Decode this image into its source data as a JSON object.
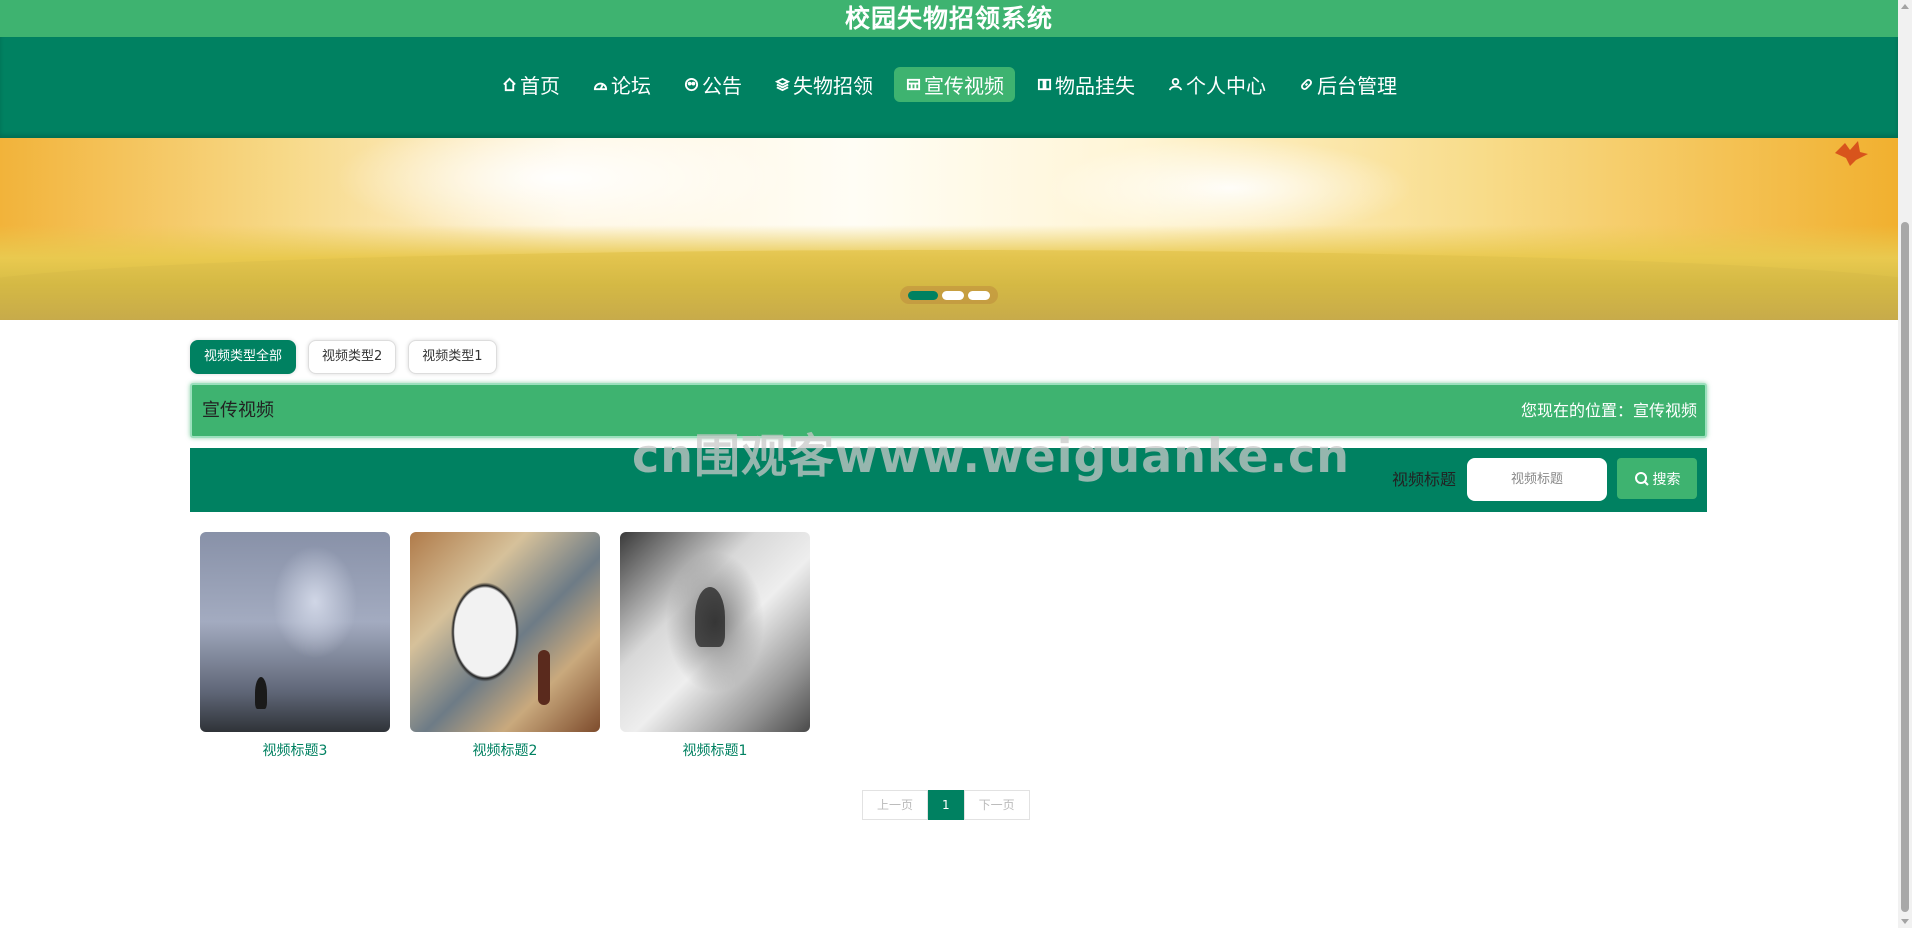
{
  "header": {
    "title": "校园失物招领系统"
  },
  "nav": {
    "items": [
      {
        "label": "首页",
        "icon": "home-icon"
      },
      {
        "label": "论坛",
        "icon": "forum-icon"
      },
      {
        "label": "公告",
        "icon": "notice-icon"
      },
      {
        "label": "失物招领",
        "icon": "layers-icon"
      },
      {
        "label": "宣传视频",
        "icon": "video-icon",
        "active": true
      },
      {
        "label": "物品挂失",
        "icon": "book-icon"
      },
      {
        "label": "个人中心",
        "icon": "user-icon"
      },
      {
        "label": "后台管理",
        "icon": "link-icon"
      }
    ]
  },
  "banner": {
    "slides": 3,
    "active_slide": 1
  },
  "filters": {
    "tabs": [
      {
        "label": "视频类型全部",
        "active": true
      },
      {
        "label": "视频类型2"
      },
      {
        "label": "视频类型1"
      }
    ]
  },
  "section": {
    "title": "宣传视频",
    "location": "您现在的位置：宣传视频"
  },
  "search": {
    "label": "视频标题",
    "placeholder": "视频标题",
    "button": "搜索"
  },
  "watermark": "cn围观客www.weiguanke.cn",
  "videos": [
    {
      "title": "视频标题3"
    },
    {
      "title": "视频标题2"
    },
    {
      "title": "视频标题1"
    }
  ],
  "pagination": {
    "prev": "上一页",
    "current": "1",
    "next": "下一页"
  },
  "colors": {
    "primary": "#008161",
    "accent": "#3eb370"
  }
}
